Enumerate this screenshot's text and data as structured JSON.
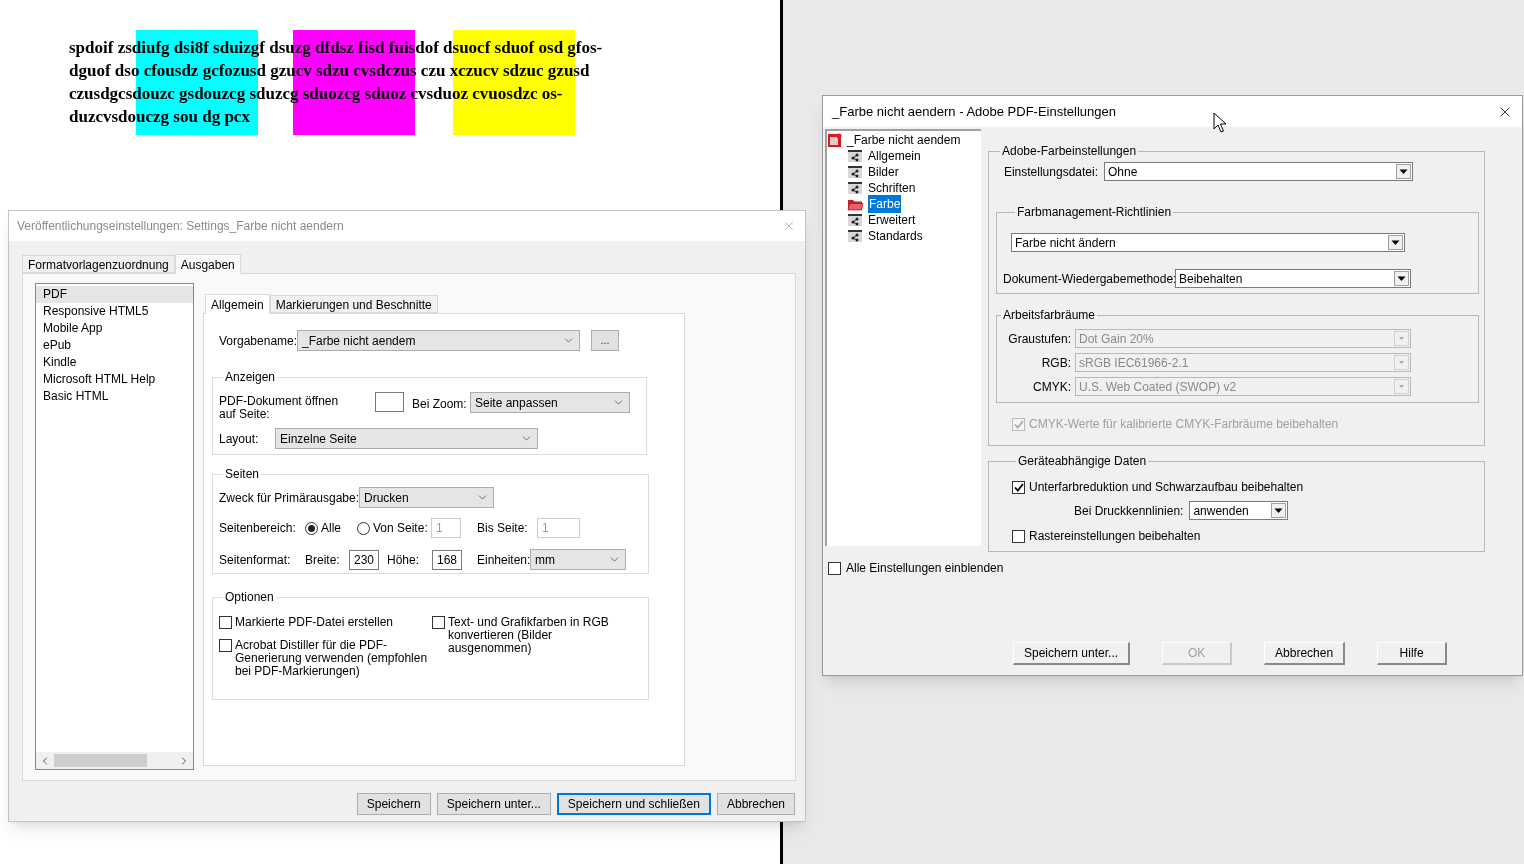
{
  "document": {
    "lines": [
      "spdoif zsdiufg dsi8f sduizgf dsuzg dfdsz fisd fuisdof dsuocf sduof osd gfos-",
      "dguof dso cfousdz gcfozusd gzucv sdzu cvsdczus czu xczucv sdzuc gzusd",
      "czusdgcsdouzc gsdouzcg sduzcg sduozcg sduoz cvsduoz cvuosdzc os-",
      "duzcvsdouczg sou dg pcx"
    ],
    "highlights": [
      {
        "color": "#00ffff"
      },
      {
        "color": "#ff00ff"
      },
      {
        "color": "#ffff00"
      }
    ]
  },
  "publish_dialog": {
    "title": "Veröffentlichungseinstellungen: Settings_Farbe nicht aendern",
    "tabs": [
      {
        "label": "Formatvorlagenzuordnung",
        "selected": false
      },
      {
        "label": "Ausgaben",
        "selected": true
      }
    ],
    "outputs": [
      {
        "label": "PDF",
        "selected": true
      },
      {
        "label": "Responsive HTML5",
        "selected": false
      },
      {
        "label": "Mobile App",
        "selected": false
      },
      {
        "label": "ePub",
        "selected": false
      },
      {
        "label": "Kindle",
        "selected": false
      },
      {
        "label": "Microsoft HTML Help",
        "selected": false
      },
      {
        "label": "Basic HTML",
        "selected": false
      }
    ],
    "subtabs": [
      {
        "label": "Allgemein",
        "selected": true
      },
      {
        "label": "Markierungen und Beschnitte",
        "selected": false
      }
    ],
    "preset": {
      "label": "Vorgabename:",
      "value": "_Farbe nicht aendem",
      "more": "..."
    },
    "display": {
      "legend": "Anzeigen",
      "open_page_label": "PDF-Dokument öffnen auf Seite:",
      "zoom_label": "Bei Zoom:",
      "zoom_value": "Seite anpassen",
      "layout_label": "Layout:",
      "layout_value": "Einzelne Seite"
    },
    "pages": {
      "legend": "Seiten",
      "purpose_label": "Zweck für Primärausgabe:",
      "purpose_value": "Drucken",
      "range_label": "Seitenbereich:",
      "range_options": [
        {
          "label": "Alle",
          "selected": true
        },
        {
          "label": "Von Seite:",
          "selected": false
        }
      ],
      "from_value": "1",
      "to_label": "Bis Seite:",
      "to_value": "1",
      "format_label": "Seitenformat:",
      "width_label": "Breite:",
      "width_value": "230",
      "height_label": "Höhe:",
      "height_value": "168",
      "units_label": "Einheiten:",
      "units_value": "mm"
    },
    "options": {
      "legend": "Optionen",
      "columns": [
        [
          {
            "label": "Markierte PDF-Datei erstellen",
            "checked": false
          },
          {
            "label": "Acrobat Distiller für die PDF-Generierung verwenden (empfohlen bei PDF-Markierungen)",
            "checked": false
          }
        ],
        [
          {
            "label": "Text- und Grafikfarben in RGB konvertieren (Bilder ausgenommen)",
            "checked": false
          }
        ]
      ]
    },
    "buttons": [
      {
        "label": "Speichern",
        "focused": false
      },
      {
        "label": "Speichern unter...",
        "focused": false
      },
      {
        "label": "Speichern und schließen",
        "focused": true
      },
      {
        "label": "Abbrechen",
        "focused": false
      }
    ]
  },
  "pdf_dialog": {
    "title": "_Farbe nicht aendern - Adobe PDF-Einstellungen",
    "tree": {
      "label": "_Farbe nicht aendem",
      "children": [
        {
          "label": "Allgemein",
          "selected": false
        },
        {
          "label": "Bilder",
          "selected": false
        },
        {
          "label": "Schriften",
          "selected": false
        },
        {
          "label": "Farbe",
          "selected": true
        },
        {
          "label": "Erweitert",
          "selected": false
        },
        {
          "label": "Standards",
          "selected": false
        }
      ]
    },
    "color_settings": {
      "legend": "Adobe-Farbeinstellungen",
      "file_label": "Einstellungsdatei:",
      "file_value": "Ohne",
      "policy": {
        "legend": "Farbmanagement-Richtlinien",
        "value": "Farbe nicht ändern",
        "intent_label": "Dokument-Wiedergabemethode:",
        "intent_value": "Beibehalten"
      },
      "working_spaces": {
        "legend": "Arbeitsfarbräume",
        "rows": [
          {
            "label": "Graustufen:",
            "value": "Dot Gain 20%",
            "disabled": true
          },
          {
            "label": "RGB:",
            "value": "sRGB IEC61966-2.1",
            "disabled": true
          },
          {
            "label": "CMYK:",
            "value": "U.S. Web Coated (SWOP) v2",
            "disabled": true
          }
        ]
      },
      "preserve_cmyk": {
        "label": "CMYK-Werte für kalibrierte CMYK-Farbräume beibehalten",
        "checked": true,
        "disabled": true
      }
    },
    "device_data": {
      "legend": "Geräteabhängige Daten",
      "ucr": {
        "label": "Unterfarbreduktion und Schwarzaufbau beibehalten",
        "checked": true
      },
      "transfer_label": "Bei Druckkennlinien:",
      "transfer_value": "anwenden",
      "halftone": {
        "label": "Rastereinstellungen beibehalten",
        "checked": false
      }
    },
    "show_all": {
      "label": "Alle Einstellungen einblenden",
      "checked": false
    },
    "buttons": [
      {
        "label": "Speichern unter...",
        "disabled": false
      },
      {
        "label": "OK",
        "disabled": true
      },
      {
        "label": "Abbrechen",
        "disabled": false
      },
      {
        "label": "Hilfe",
        "disabled": false
      }
    ]
  }
}
